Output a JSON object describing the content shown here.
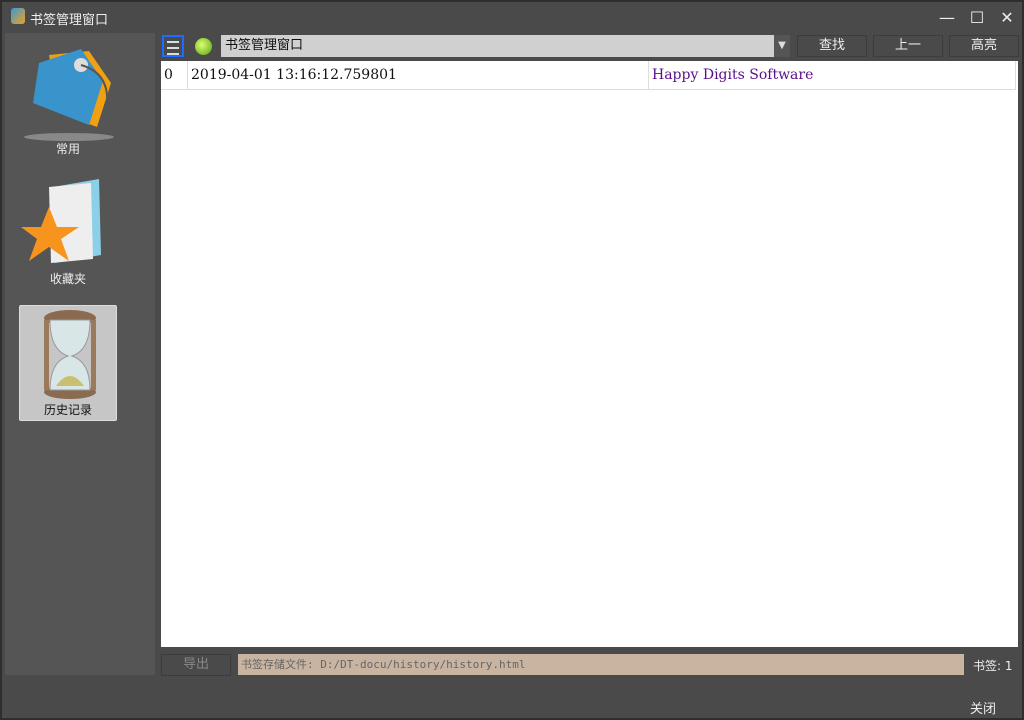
{
  "window": {
    "title": "书签管理窗口",
    "minimize": "—",
    "maximize": "☐",
    "close": "✕"
  },
  "sidebar": {
    "items": [
      {
        "label": "常用",
        "icon": "tag-icon"
      },
      {
        "label": "收藏夹",
        "icon": "star-folder-icon"
      },
      {
        "label": "历史记录",
        "icon": "hourglass-icon",
        "selected": true
      }
    ]
  },
  "toolbar": {
    "combo_value": "书签管理窗口",
    "find": "查找",
    "prev": "上一",
    "highlight": "高亮"
  },
  "table": {
    "rows": [
      {
        "index": "0",
        "time": "2019-04-01 13:16:12.759801",
        "title": "Happy Digits Software"
      }
    ]
  },
  "footer": {
    "export": "导出",
    "path": "书签存储文件: D:/DT-docu/history/history.html",
    "count": "书签: 1",
    "close": "关闭"
  },
  "colors": {
    "link": "#5a0f8a",
    "accent": "#1e6cff",
    "path_bg": "#c8b4a0"
  }
}
